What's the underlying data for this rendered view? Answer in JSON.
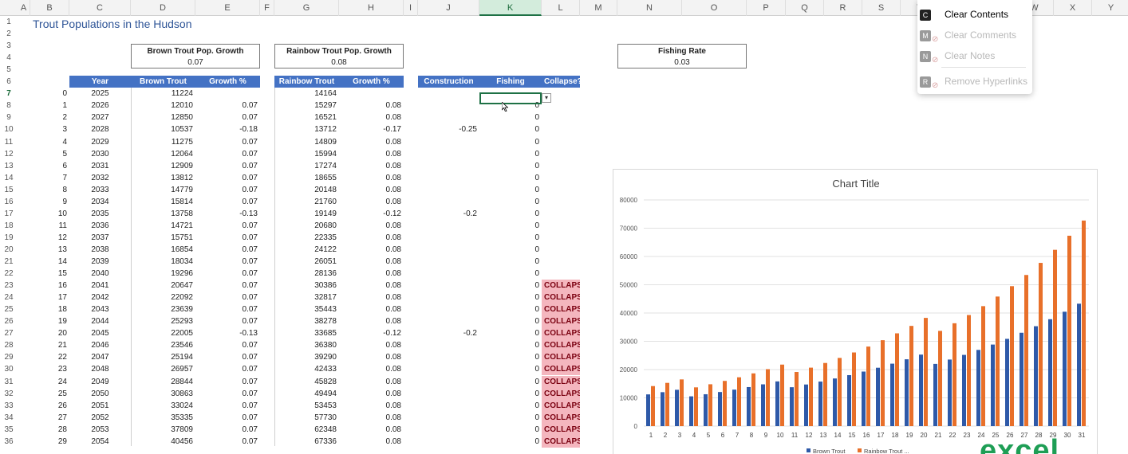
{
  "columns": [
    "A",
    "B",
    "C",
    "D",
    "E",
    "F",
    "G",
    "H",
    "I",
    "J",
    "K",
    "L",
    "M",
    "N",
    "O",
    "P",
    "Q",
    "R",
    "S",
    "T",
    "U",
    "V",
    "W",
    "X",
    "Y"
  ],
  "selected_column": "K",
  "selected_row": 7,
  "rows": [
    1,
    2,
    3,
    4,
    5,
    6,
    7,
    8,
    9,
    10,
    11,
    12,
    13,
    14,
    15,
    16,
    17,
    18,
    19,
    20,
    21,
    22,
    23,
    24,
    25,
    26,
    27,
    28,
    29,
    30,
    31,
    32,
    33,
    34,
    35,
    36
  ],
  "sheet_title": "Trout Populations in the Hudson",
  "brown_growth": {
    "label": "Brown Trout Pop. Growth",
    "value": "0.07"
  },
  "rainbow_growth": {
    "label": "Rainbow Trout Pop. Growth",
    "value": "0.08"
  },
  "fishing_rate": {
    "label": "Fishing Rate",
    "value": "0.03"
  },
  "headers": {
    "year": "Year",
    "brown": "Brown Trout",
    "growth1": "Growth %",
    "rainbow": "Rainbow Trout",
    "growth2": "Growth %",
    "construction": "Construction",
    "fishing": "Fishing",
    "collapse": "Collapse?"
  },
  "table": [
    {
      "b": "0",
      "year": "2025",
      "brown": "11224",
      "g1": "",
      "rainbow": "14164",
      "g2": "",
      "cons": "",
      "fish": "",
      "col": ""
    },
    {
      "b": "1",
      "year": "2026",
      "brown": "12010",
      "g1": "0.07",
      "rainbow": "15297",
      "g2": "0.08",
      "cons": "",
      "fish": "0",
      "col": ""
    },
    {
      "b": "2",
      "year": "2027",
      "brown": "12850",
      "g1": "0.07",
      "rainbow": "16521",
      "g2": "0.08",
      "cons": "",
      "fish": "0",
      "col": ""
    },
    {
      "b": "3",
      "year": "2028",
      "brown": "10537",
      "g1": "-0.18",
      "rainbow": "13712",
      "g2": "-0.17",
      "cons": "-0.25",
      "fish": "0",
      "col": ""
    },
    {
      "b": "4",
      "year": "2029",
      "brown": "11275",
      "g1": "0.07",
      "rainbow": "14809",
      "g2": "0.08",
      "cons": "",
      "fish": "0",
      "col": ""
    },
    {
      "b": "5",
      "year": "2030",
      "brown": "12064",
      "g1": "0.07",
      "rainbow": "15994",
      "g2": "0.08",
      "cons": "",
      "fish": "0",
      "col": ""
    },
    {
      "b": "6",
      "year": "2031",
      "brown": "12909",
      "g1": "0.07",
      "rainbow": "17274",
      "g2": "0.08",
      "cons": "",
      "fish": "0",
      "col": ""
    },
    {
      "b": "7",
      "year": "2032",
      "brown": "13812",
      "g1": "0.07",
      "rainbow": "18655",
      "g2": "0.08",
      "cons": "",
      "fish": "0",
      "col": ""
    },
    {
      "b": "8",
      "year": "2033",
      "brown": "14779",
      "g1": "0.07",
      "rainbow": "20148",
      "g2": "0.08",
      "cons": "",
      "fish": "0",
      "col": ""
    },
    {
      "b": "9",
      "year": "2034",
      "brown": "15814",
      "g1": "0.07",
      "rainbow": "21760",
      "g2": "0.08",
      "cons": "",
      "fish": "0",
      "col": ""
    },
    {
      "b": "10",
      "year": "2035",
      "brown": "13758",
      "g1": "-0.13",
      "rainbow": "19149",
      "g2": "-0.12",
      "cons": "-0.2",
      "fish": "0",
      "col": ""
    },
    {
      "b": "11",
      "year": "2036",
      "brown": "14721",
      "g1": "0.07",
      "rainbow": "20680",
      "g2": "0.08",
      "cons": "",
      "fish": "0",
      "col": ""
    },
    {
      "b": "12",
      "year": "2037",
      "brown": "15751",
      "g1": "0.07",
      "rainbow": "22335",
      "g2": "0.08",
      "cons": "",
      "fish": "0",
      "col": ""
    },
    {
      "b": "13",
      "year": "2038",
      "brown": "16854",
      "g1": "0.07",
      "rainbow": "24122",
      "g2": "0.08",
      "cons": "",
      "fish": "0",
      "col": ""
    },
    {
      "b": "14",
      "year": "2039",
      "brown": "18034",
      "g1": "0.07",
      "rainbow": "26051",
      "g2": "0.08",
      "cons": "",
      "fish": "0",
      "col": ""
    },
    {
      "b": "15",
      "year": "2040",
      "brown": "19296",
      "g1": "0.07",
      "rainbow": "28136",
      "g2": "0.08",
      "cons": "",
      "fish": "0",
      "col": ""
    },
    {
      "b": "16",
      "year": "2041",
      "brown": "20647",
      "g1": "0.07",
      "rainbow": "30386",
      "g2": "0.08",
      "cons": "",
      "fish": "0",
      "col": "COLLAPSE"
    },
    {
      "b": "17",
      "year": "2042",
      "brown": "22092",
      "g1": "0.07",
      "rainbow": "32817",
      "g2": "0.08",
      "cons": "",
      "fish": "0",
      "col": "COLLAPSE"
    },
    {
      "b": "18",
      "year": "2043",
      "brown": "23639",
      "g1": "0.07",
      "rainbow": "35443",
      "g2": "0.08",
      "cons": "",
      "fish": "0",
      "col": "COLLAPSE"
    },
    {
      "b": "19",
      "year": "2044",
      "brown": "25293",
      "g1": "0.07",
      "rainbow": "38278",
      "g2": "0.08",
      "cons": "",
      "fish": "0",
      "col": "COLLAPSE"
    },
    {
      "b": "20",
      "year": "2045",
      "brown": "22005",
      "g1": "-0.13",
      "rainbow": "33685",
      "g2": "-0.12",
      "cons": "-0.2",
      "fish": "0",
      "col": "COLLAPSE"
    },
    {
      "b": "21",
      "year": "2046",
      "brown": "23546",
      "g1": "0.07",
      "rainbow": "36380",
      "g2": "0.08",
      "cons": "",
      "fish": "0",
      "col": "COLLAPSE"
    },
    {
      "b": "22",
      "year": "2047",
      "brown": "25194",
      "g1": "0.07",
      "rainbow": "39290",
      "g2": "0.08",
      "cons": "",
      "fish": "0",
      "col": "COLLAPSE"
    },
    {
      "b": "23",
      "year": "2048",
      "brown": "26957",
      "g1": "0.07",
      "rainbow": "42433",
      "g2": "0.08",
      "cons": "",
      "fish": "0",
      "col": "COLLAPSE"
    },
    {
      "b": "24",
      "year": "2049",
      "brown": "28844",
      "g1": "0.07",
      "rainbow": "45828",
      "g2": "0.08",
      "cons": "",
      "fish": "0",
      "col": "COLLAPSE"
    },
    {
      "b": "25",
      "year": "2050",
      "brown": "30863",
      "g1": "0.07",
      "rainbow": "49494",
      "g2": "0.08",
      "cons": "",
      "fish": "0",
      "col": "COLLAPSE"
    },
    {
      "b": "26",
      "year": "2051",
      "brown": "33024",
      "g1": "0.07",
      "rainbow": "53453",
      "g2": "0.08",
      "cons": "",
      "fish": "0",
      "col": "COLLAPSE"
    },
    {
      "b": "27",
      "year": "2052",
      "brown": "35335",
      "g1": "0.07",
      "rainbow": "57730",
      "g2": "0.08",
      "cons": "",
      "fish": "0",
      "col": "COLLAPSE"
    },
    {
      "b": "28",
      "year": "2053",
      "brown": "37809",
      "g1": "0.07",
      "rainbow": "62348",
      "g2": "0.08",
      "cons": "",
      "fish": "0",
      "col": "COLLAPSE"
    },
    {
      "b": "29",
      "year": "2054",
      "brown": "40456",
      "g1": "0.07",
      "rainbow": "67336",
      "g2": "0.08",
      "cons": "",
      "fish": "0",
      "col": "COLLAPSE"
    }
  ],
  "context_menu": {
    "items": [
      {
        "key": "C",
        "label": "Clear Contents",
        "enabled": true,
        "icon": ""
      },
      {
        "key": "M",
        "label": "Clear Comments",
        "enabled": false,
        "icon": "comment-clear-icon"
      },
      {
        "key": "N",
        "label": "Clear Notes",
        "enabled": false,
        "icon": "note-clear-icon"
      },
      {
        "key": "R",
        "label": "Remove Hyperlinks",
        "enabled": false,
        "icon": "link-remove-icon"
      }
    ]
  },
  "colors": {
    "header_blue": "#4472c4",
    "brown_bar": "#2e59a8",
    "rainbow_bar": "#e8702a",
    "collapse_fill": "#f4b6be",
    "title_blue": "#2f5597"
  },
  "logo_text": "excel",
  "chart_data": {
    "type": "bar",
    "title": "Chart Title",
    "categories": [
      "1",
      "2",
      "3",
      "4",
      "5",
      "6",
      "7",
      "8",
      "9",
      "10",
      "11",
      "12",
      "13",
      "14",
      "15",
      "16",
      "17",
      "18",
      "19",
      "20",
      "21",
      "22",
      "23",
      "24",
      "25",
      "26",
      "27",
      "28",
      "29",
      "30",
      "31"
    ],
    "series": [
      {
        "name": "Brown Trout",
        "values": [
          11224,
          12010,
          12850,
          10537,
          11275,
          12064,
          12909,
          13812,
          14779,
          15814,
          13758,
          14721,
          15751,
          16854,
          18034,
          19296,
          20647,
          22092,
          23639,
          25293,
          22005,
          23546,
          25194,
          26957,
          28844,
          30863,
          33024,
          35335,
          37809,
          40456,
          43300
        ]
      },
      {
        "name": "Rainbow Trout ...",
        "values": [
          14164,
          15297,
          16521,
          13712,
          14809,
          15994,
          17274,
          18655,
          20148,
          21760,
          19149,
          20680,
          22335,
          24122,
          26051,
          28136,
          30386,
          32817,
          35443,
          38278,
          33685,
          36380,
          39290,
          42433,
          45828,
          49494,
          53453,
          57730,
          62348,
          67336,
          72700
        ]
      }
    ],
    "yticks": [
      "0",
      "10000",
      "20000",
      "30000",
      "40000",
      "50000",
      "60000",
      "70000",
      "80000"
    ],
    "ylim": [
      0,
      80000
    ],
    "grid": true,
    "legend": "bottom"
  }
}
